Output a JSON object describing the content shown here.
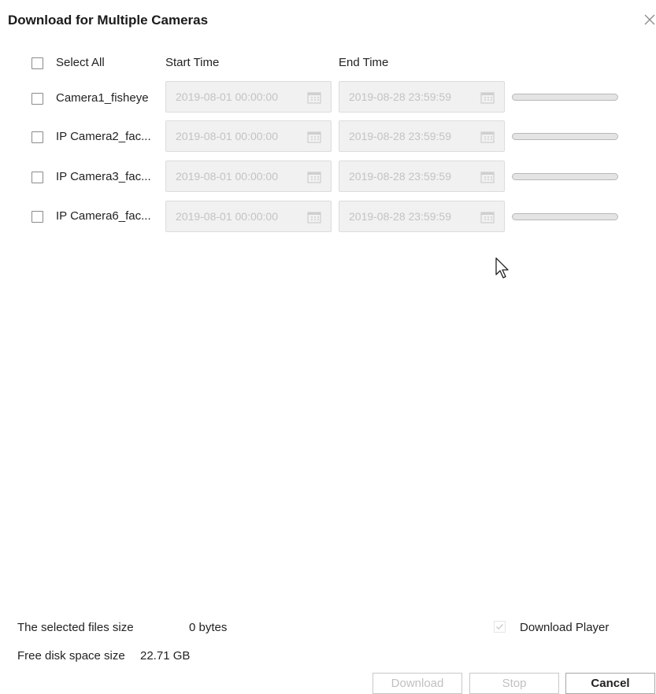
{
  "dialog": {
    "title": "Download for Multiple Cameras"
  },
  "header": {
    "select_all": "Select All",
    "start_time": "Start Time",
    "end_time": "End Time"
  },
  "cameras": [
    {
      "name": "Camera1_fisheye",
      "start": "2019-08-01 00:00:00",
      "end": "2019-08-28 23:59:59",
      "progress": 0
    },
    {
      "name": "IP Camera2_fac...",
      "start": "2019-08-01 00:00:00",
      "end": "2019-08-28 23:59:59",
      "progress": 0
    },
    {
      "name": "IP Camera3_fac...",
      "start": "2019-08-01 00:00:00",
      "end": "2019-08-28 23:59:59",
      "progress": 0
    },
    {
      "name": "IP Camera6_fac...",
      "start": "2019-08-01 00:00:00",
      "end": "2019-08-28 23:59:59",
      "progress": 0
    }
  ],
  "footer": {
    "selected_size_label": "The selected files size",
    "selected_size_value": "0 bytes",
    "free_disk_label": "Free disk space size",
    "free_disk_value": "22.71 GB",
    "download_player_label": "Download Player",
    "download_player_checked": true
  },
  "buttons": {
    "download": "Download",
    "stop": "Stop",
    "cancel": "Cancel"
  },
  "icons": {
    "close": "close-icon",
    "calendar": "calendar-icon",
    "cursor": "mouse-cursor-icon"
  }
}
